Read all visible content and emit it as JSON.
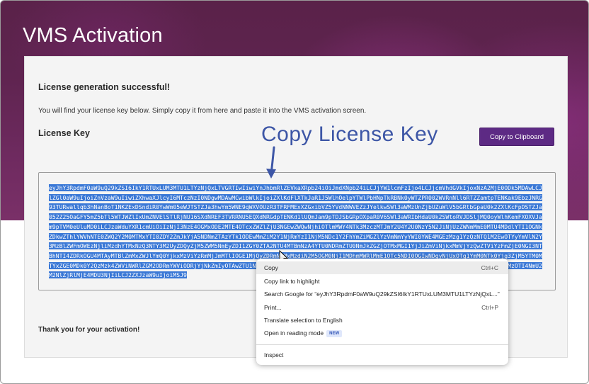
{
  "page": {
    "title": "VMS Activation",
    "success_heading": "License generation successful!",
    "instructions": "You will find your license key below. Simply copy it from here and paste it into the VMS activation screen.",
    "license_key_heading": "License Key",
    "copy_button_label": "Copy to Clipboard",
    "thanks": "Thank you for your activation!"
  },
  "annotation": {
    "text": "Copy License Key",
    "color": "#3d56a6"
  },
  "license_key": {
    "lines": [
      "eyJhY3RpdmF0aW9uQ29kZSI6IkY1RTUxLUM3MTU1LTYzNjQxLTVGRTIwIiwiYnJhbmRlZEVkaXRpb24iOiJmdXNpb24iLCJjYW1lcmFzIjo4LCJjcmVhdGVkIjoxNzA2MjE0ODk5",
      "MDAwLCJlZGl0aW9uIjoiZnVzaW9uIiwiZXhwaXJlcyI6MTczNzI0NDgwMDAwMCwibWlkIjoiZXlKdFlXTkJaR1J5WlhOelpYTWlPbHNpTkRBNk0yWTZPR002WVRnNll6RTZZamtp",
      "TENKak9EbzJNRG93TURwallqb3hNanBoT1NKZExDSndiR0YwWm05eWJTSTZJa3hwYm5WNE9qWXVOUzR3TFRFMExXZGxibVZ5YVdNNWVEZzJYelkwSWl3aWMzUnZjbUZuWlV5bGRt",
      "bGpaU0k2ZXlKcFpDSTZJa052Z25OaGFY5mZ5bTl5WTJWZlIxUmZNVElSTlRjNU16SXdNREF3TVRRNU5EQXdNRGdpTENKd1lUQmJam9pTDJSbGRpOXpaR0V6SWl3aWRIbHdaU0k2",
      "SWtoRVJDSljMQ0oyWlhKemFXOXVJam9pTVM0eUluMD0iLCJzaWduYXR1cmUiOiIzNjI3NzE4OGMxODE2MTE4OTcxZWZlZjU3NGEwZWQwNjhiOTlmMWY4NTk3MzczMTJmY2U4Y2U0",
      "NzY5N2JiNjUzZWNmMmE0MTU4MDdlYTI1OGNkZDkwZThlYWVhNTE0ZWQ2Y2M0MTMxYTI0ZDY2ZmJkYjA5NDNmZTAzYTk1ODEwMmZiM2Y1NjRmYzI1NjM5NDc1Y2FhYmZiMGZlYzVm",
      "NmYyYWI0YWE4MGEzMzg1YzQzNTQ1M2EwOTYyYmVlN2Y3MzBlZWFmOWEzNjliMzdhYTMxNzQ3NTY3M2UyZDQyZjM5ZWM5NmEyZDI1ZGY0ZTA2NTU4MTBmNzA4YTU0NDRmZTU0NmJk",
      "ZGZjOTMxMGI1YjJiZmViNjkxMmVjYzQwZTViYzFmZjE0NGI3NTBhNTI4ZDRkOGU4MTAyMTBlZmMxZWJlYmQ0YjkxMzViYzRmMjJmMTlIOGE1MjQyZDRmNzMxMzdiN2M5OGM0NjI1",
      "MDhmMWRlMmE1OTc5NDI0OGIwNDgyNjUxOTg1YmM0NTk0Yjg3ZjM5YTM0MTYxZGE0MDk0Y2QzMzk4ZWViNWRlZGM2ODRmYWViODRjYjNkZmIyOTAwZTU1N2JmYzhkNzg1MGEzNjZm",
      "MzJkOTFhMDQ2OGVlZDMwMDcxNDJlMjczNTI4OGY5Zjk5MGVjY2E2ODMzOTI4NmU2M2NlZjRlMjE4MDU3NjIiLCJ2ZXJzaW9uIjoiMSJ9"
    ],
    "selection_color": "#3a78d6"
  },
  "context_menu": {
    "items": [
      {
        "label": "Copy",
        "shortcut": "Ctrl+C"
      },
      {
        "label": "Copy link to highlight",
        "shortcut": ""
      },
      {
        "label": "Search Google for “eyJhY3RpdmF0aW9uQ29kZSI6IkY1RTUxLUM3MTU1LTYzNjQxL...”",
        "shortcut": ""
      },
      {
        "label": "Print...",
        "shortcut": "Ctrl+P"
      },
      {
        "label": "Translate selection to English",
        "shortcut": ""
      },
      {
        "label": "Open in reading mode",
        "shortcut": "",
        "badge": "NEW"
      },
      {
        "label": "Inspect",
        "shortcut": ""
      }
    ]
  },
  "colors": {
    "accent_button": "#5d2a84",
    "header_background": "#5f2450"
  }
}
